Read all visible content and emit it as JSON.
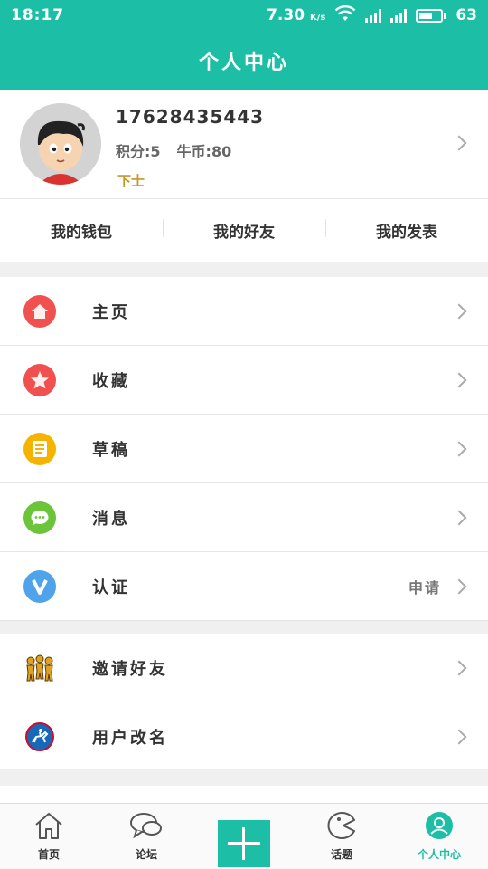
{
  "status_bar": {
    "time": "18:17",
    "speed": "7.30",
    "speed_unit": "K/s",
    "battery": "63"
  },
  "header": {
    "title": "个人中心"
  },
  "profile": {
    "phone": "17628435443",
    "points": "积分:5",
    "coins": "牛币:80",
    "rank": "下士"
  },
  "quick_tabs": [
    {
      "label": "我的钱包"
    },
    {
      "label": "我的好友"
    },
    {
      "label": "我的发表"
    }
  ],
  "menu": [
    {
      "label": "主页",
      "icon": "home-icon",
      "color": "#f0504e"
    },
    {
      "label": "收藏",
      "icon": "star-icon",
      "color": "#f0504e"
    },
    {
      "label": "草稿",
      "icon": "draft-icon",
      "color": "#f5b400"
    },
    {
      "label": "消息",
      "icon": "message-icon",
      "color": "#6cc43a"
    },
    {
      "label": "认证",
      "icon": "verify-icon",
      "color": "#4ea3ea",
      "extra": "申请"
    }
  ],
  "menu2": [
    {
      "label": "邀请好友",
      "icon": "invite-friends-icon"
    },
    {
      "label": "用户改名",
      "icon": "rename-icon"
    }
  ],
  "bottom_nav": [
    {
      "label": "首页",
      "icon": "home-outline-icon"
    },
    {
      "label": "论坛",
      "icon": "forum-icon"
    },
    {
      "label": "",
      "icon": "plus-icon"
    },
    {
      "label": "话题",
      "icon": "topic-icon"
    },
    {
      "label": "个人中心",
      "icon": "profile-icon",
      "active": true
    }
  ],
  "colors": {
    "accent": "#1cbfa6"
  }
}
